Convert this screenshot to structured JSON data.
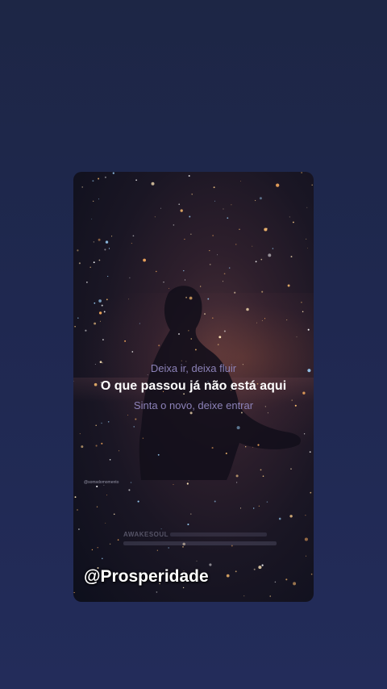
{
  "video": {
    "lyrics": {
      "previous": "Deixa ir, deixa fluir",
      "current": "O que passou já não está aqui",
      "next": "Sinta o novo, deixe entrar"
    },
    "small_tag": "@somsdomomento",
    "watermark_brand": "AWAKESOUL",
    "handle": "@Prosperidade"
  },
  "colors": {
    "page_background": "#1f2850",
    "lyric_dim": "#8c82b8",
    "lyric_active": "#ffffff"
  }
}
